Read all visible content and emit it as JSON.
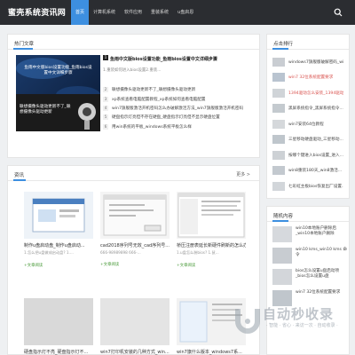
{
  "site": {
    "name": "蜜壳系统资讯网"
  },
  "nav": {
    "items": [
      "首页",
      "计算机系统",
      "软件应用",
      "重装系统",
      "u盘启恩"
    ]
  },
  "hot": {
    "title": "热门文章",
    "thumb1_caption": "鱼雨中文版bios设置功能_鱼雨bios设置中文详细步骤",
    "thumb2_caption": "联想摄像头驱动更新不了_联想摄像头驱动更新",
    "featured_title": "鱼雨中文版bios设置功能_鱼雨bios设置中文详细步骤",
    "featured_desc": "1.重装如何进入bios设置2.重装...",
    "list": [
      {
        "num": "2",
        "text": "联想摄像头驱动更新不了_联想摄像头驱动更新"
      },
      {
        "num": "3",
        "text": "xp系统查看电脑配置教程_xp系统如何查看电脑配置"
      },
      {
        "num": "4",
        "text": "win7旗舰版激活开机密码怎么办破解激活方法_win7旗舰版激活开机密码"
      },
      {
        "num": "5",
        "text": "硬盘指示灯亮但不存在硬盘_硬盘指示灯亮但不显示硬盘位置"
      },
      {
        "num": "6",
        "text": "用win系统的平板_windows系统平板怎么样"
      }
    ]
  },
  "info": {
    "title": "资讯",
    "more": "更多 >",
    "cards": [
      {
        "title": "制作u盘启动盘_制作u盘启动...",
        "desc": "1.怎么把u盘做成启动盘? 1....",
        "more": "+文章阅读"
      },
      {
        "title": "cad2018序列号无效_cad序列号...",
        "desc": "666-98989898 666-...",
        "more": "+文章阅读"
      },
      {
        "title": "桥压注册表延长新硬件刷新的怎么办...",
        "desc": "1.u盘怎么装bios? 1.鼠...",
        "more": "+文章阅读"
      },
      {
        "title": "硬盘指示灯不亮_硬盘指示灯不...",
        "desc": "",
        "more": ""
      },
      {
        "title": "win7打印机安装的几种方式_win...",
        "desc": "",
        "more": ""
      },
      {
        "title": "win7旗什么版本_windows7系...",
        "desc": "",
        "more": ""
      }
    ]
  },
  "ranking": {
    "title": "点击排行",
    "items": [
      {
        "text": "windows7旗舰版破解密码_win...",
        "red": false
      },
      {
        "text": "win7 32位系统配置要求",
        "red": true
      },
      {
        "text": "1394驱动怎么安装_1394驱动...",
        "red": true
      },
      {
        "text": "黑屏系统指令_黑屏系统指令...",
        "red": false
      },
      {
        "text": "win7安装64位教程",
        "red": false
      },
      {
        "text": "三星移动硬盘驱动_三星移动...",
        "red": false
      },
      {
        "text": "按哪个键进入bios设置_进入...",
        "red": false
      },
      {
        "text": "win8重装180天_win8激活...",
        "red": false
      },
      {
        "text": "七彩虹主板bios恢复出厂设置...",
        "red": false
      }
    ]
  },
  "random": {
    "title": "随机内容",
    "items": [
      {
        "text": "win10本地账户删除后_win10本地账户删除"
      },
      {
        "text": "win10 kms_win10 kms 命令"
      },
      {
        "text": "bios怎么设置u盘启动项_bios怎么设置u盘"
      },
      {
        "text": "win7 32位系统配置要求"
      }
    ]
  },
  "watermark": {
    "text": "自动秒收录",
    "sub": "· 智能 · 省心 · 来访一次 · 自动收录 ·"
  },
  "colors": {
    "header": "#2b2d31",
    "accent": "#3d8fe0",
    "link_green": "#4a9a3a"
  }
}
